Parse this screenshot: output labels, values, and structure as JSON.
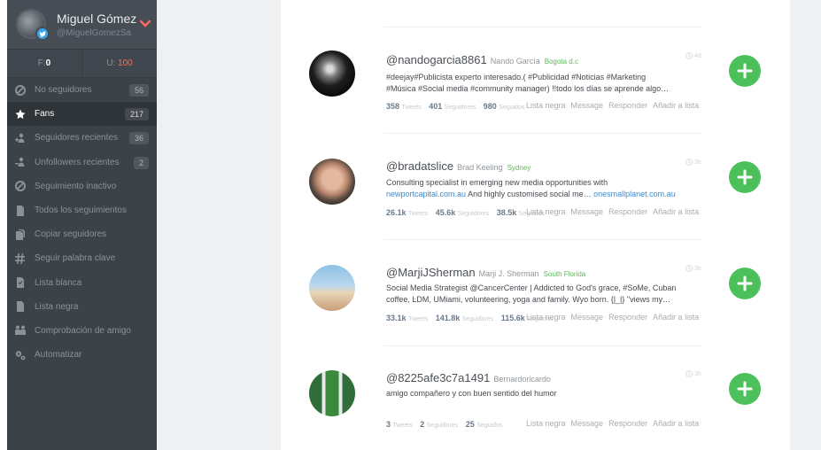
{
  "profile": {
    "name": "Miguel Gómez",
    "handle": "@MiguelGomezSa"
  },
  "counts": {
    "f_label": "F:",
    "f_value": "0",
    "u_label": "U:",
    "u_value": "100"
  },
  "sidebar": {
    "items": [
      {
        "label": "No seguidores",
        "badge": "56",
        "icon": "ban-icon"
      },
      {
        "label": "Fans",
        "badge": "217",
        "icon": "star-icon"
      },
      {
        "label": "Seguidores recientes",
        "badge": "36",
        "icon": "user-add-icon"
      },
      {
        "label": "Unfollowers recientes",
        "badge": "2",
        "icon": "user-remove-icon"
      },
      {
        "label": "Seguimiento inactivo",
        "icon": "ban-icon"
      },
      {
        "label": "Todos los seguimientos",
        "icon": "document-icon"
      },
      {
        "label": "Copiar seguidores",
        "icon": "copy-icon"
      },
      {
        "label": "Seguir palabra clave",
        "icon": "hashtag-icon"
      },
      {
        "label": "Lista blanca",
        "icon": "list-check-icon"
      },
      {
        "label": "Lista negra",
        "icon": "list-icon"
      },
      {
        "label": "Comprobación de amigo",
        "icon": "users-icon"
      },
      {
        "label": "Automatizar",
        "icon": "gears-icon"
      }
    ]
  },
  "users": [
    {
      "handle": "@nandogarcia8861",
      "real_name": "Nando García",
      "location": "Bogota d.c",
      "time": "4d",
      "bio_line1": "#deejay#Publicista experto interesado.( #Publicidad #Noticias #Marketing",
      "bio_line2": "#Música #Social media #community manager) !!todo los días se aprende algo…",
      "tweets": "358",
      "tweets_label": "Tweets",
      "followers": "401",
      "followers_label": "Seguidores",
      "following": "980",
      "following_label": "Seguidos"
    },
    {
      "handle": "@bradatslice",
      "real_name": "Brad Keeling",
      "location": "Sydney",
      "time": "3h",
      "bio_line1": "Consulting specialist in emerging new media opportunities with",
      "bio_line2_link1": "newportcapital.com.au",
      "bio_line2_mid": " And highly customised social me… ",
      "bio_line2_link2": "onesmallplanet.com.au",
      "tweets": "26.1k",
      "tweets_label": "Tweets",
      "followers": "45.6k",
      "followers_label": "Seguidores",
      "following": "38.5k",
      "following_label": "Seguidos"
    },
    {
      "handle": "@MarjiJSherman",
      "real_name": "Marji J. Sherman",
      "location": "South Florida",
      "time": "3h",
      "bio_line1": "Social Media Strategist @CancerCenter | Addicted to God's grace, #SoMe, Cuban",
      "bio_line2": "coffee, ĿDM, UMiami, volunteering, yoga and family. Wyo born. {|_|} \"views my…",
      "tweets": "33.1k",
      "tweets_label": "Tweets",
      "followers": "141.8k",
      "followers_label": "Seguidores",
      "following": "115.6k",
      "following_label": "Seguidos"
    },
    {
      "handle": "@8225afe3c7a1491",
      "real_name": "Bernardoricardo",
      "location": "",
      "time": "3h",
      "bio_line1": "amigo compañero y con buen sentido del humor",
      "bio_line2": "",
      "tweets": "3",
      "tweets_label": "Tweets",
      "followers": "2",
      "followers_label": "Seguidores",
      "following": "25",
      "following_label": "Seguidos"
    }
  ],
  "actions": {
    "blacklist": "Lista negra",
    "message": "Message",
    "reply": "Responder",
    "add_to_list": "Añadir a lista"
  },
  "colors": {
    "sidebar": "#3c4248",
    "follow": "#4cc05a",
    "location": "#5cb85c",
    "link": "#3a8ad1",
    "unfollow_count": "#ff6b5a"
  }
}
